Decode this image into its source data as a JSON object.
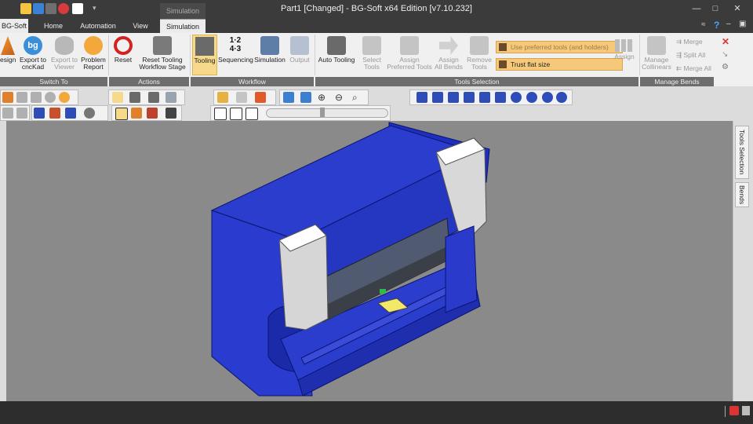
{
  "window": {
    "title": "Part1 [Changed] - BG-Soft x64 Edition [v7.10.232]",
    "context_tab": "Simulation",
    "controls": [
      "—",
      "□",
      "✕"
    ]
  },
  "tabs": [
    "BG-Soft",
    "Home",
    "Automation",
    "View",
    "Simulation"
  ],
  "ribbon": {
    "groups": [
      {
        "label": "Switch To"
      },
      {
        "label": "Actions"
      },
      {
        "label": "Workflow"
      },
      {
        "label": "Tools Selection"
      },
      {
        "label": "Manage Bends"
      }
    ],
    "switch_to": {
      "design": "esign",
      "export_cnckad_1": "Export to",
      "export_cnckad_2": "cncKad",
      "export_viewer_1": "Export to",
      "export_viewer_2": "Viewer",
      "problem_1": "Problem",
      "problem_2": "Report"
    },
    "actions": {
      "reset": "Reset",
      "reset_tooling_1": "Reset Tooling",
      "reset_tooling_2": "Workflow Stage"
    },
    "workflow": {
      "tooling": "Tooling",
      "sequencing": "Sequencing",
      "simulation": "Simulation",
      "output": "Output"
    },
    "tools_selection": {
      "auto_tooling": "Auto Tooling",
      "select_tools_1": "Select",
      "select_tools_2": "Tools",
      "assign_pref_1": "Assign",
      "assign_pref_2": "Preferred Tools",
      "assign_all_1": "Assign",
      "assign_all_2": "All Bends",
      "remove_tools_1": "Remove",
      "remove_tools_2": "Tools",
      "use_preferred": "Use preferred tools (and holders)",
      "trust_flat": "Trust flat size",
      "assign": "Assign"
    },
    "manage_bends": {
      "manage_collinears_1": "Manage",
      "manage_collinears_2": "Collinears",
      "merge": "Merge",
      "split_all": "Split All",
      "merge_all": "Merge All"
    }
  },
  "side_tabs": [
    "Tools Selection",
    "Bends"
  ],
  "colors": {
    "accent_active": "#f6d98a",
    "machine_blue": "#2b3dcc",
    "group_label_bg": "#6d6d6d"
  }
}
